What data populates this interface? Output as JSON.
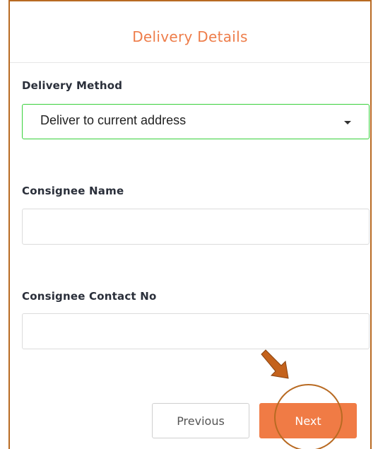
{
  "form": {
    "title": "Delivery Details",
    "delivery_method": {
      "label": "Delivery Method",
      "selected_value": "Deliver to current address"
    },
    "consignee_name": {
      "label": "Consignee Name",
      "value": ""
    },
    "consignee_contact": {
      "label": "Consignee Contact No",
      "value": ""
    },
    "buttons": {
      "previous": "Previous",
      "next": "Next"
    }
  },
  "annotation": {
    "arrow_icon": "down-right-arrow-icon",
    "highlight": "circle-highlight"
  },
  "colors": {
    "accent": "#f07b45",
    "title": "#ee7d4a",
    "frame_border": "#b86a22",
    "select_border_active": "#38d13b",
    "annotation": "#c4621c"
  }
}
